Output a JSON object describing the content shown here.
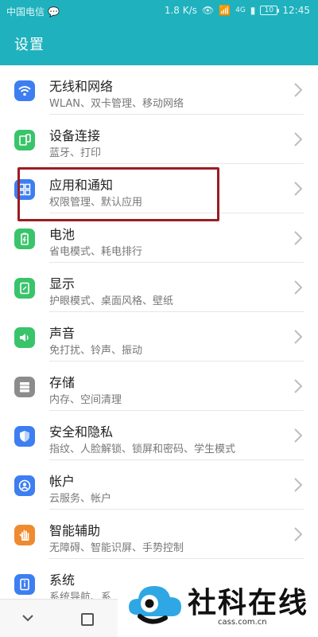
{
  "status_bar": {
    "carrier": "中国电信",
    "speed": "1.8 K/s",
    "network": "4G",
    "battery": "10",
    "time": "12:45"
  },
  "header": {
    "title": "设置"
  },
  "items": [
    {
      "title": "无线和网络",
      "subtitle": "WLAN、双卡管理、移动网络",
      "icon": "wifi-icon",
      "color": "#3d7ef2"
    },
    {
      "title": "设备连接",
      "subtitle": "蓝牙、打印",
      "icon": "device-connect-icon",
      "color": "#39c46a"
    },
    {
      "title": "应用和通知",
      "subtitle": "权限管理、默认应用",
      "icon": "apps-icon",
      "color": "#3d7ef2"
    },
    {
      "title": "电池",
      "subtitle": "省电模式、耗电排行",
      "icon": "battery-icon",
      "color": "#39c46a"
    },
    {
      "title": "显示",
      "subtitle": "护眼模式、桌面风格、壁纸",
      "icon": "display-icon",
      "color": "#39c46a"
    },
    {
      "title": "声音",
      "subtitle": "免打扰、铃声、振动",
      "icon": "sound-icon",
      "color": "#39c46a"
    },
    {
      "title": "存储",
      "subtitle": "内存、空间清理",
      "icon": "storage-icon",
      "color": "#8c8c8c"
    },
    {
      "title": "安全和隐私",
      "subtitle": "指纹、人脸解锁、锁屏和密码、学生模式",
      "icon": "shield-icon",
      "color": "#3d7ef2"
    },
    {
      "title": "帐户",
      "subtitle": "云服务、帐户",
      "icon": "account-icon",
      "color": "#3d7ef2"
    },
    {
      "title": "智能辅助",
      "subtitle": "无障碍、智能识屏、手势控制",
      "icon": "hand-icon",
      "color": "#f08a2f"
    },
    {
      "title": "系统",
      "subtitle": "系统导航、系",
      "icon": "system-icon",
      "color": "#3d7ef2"
    }
  ],
  "watermark": {
    "name": "社科在线",
    "domain": "cass.com.cn"
  }
}
